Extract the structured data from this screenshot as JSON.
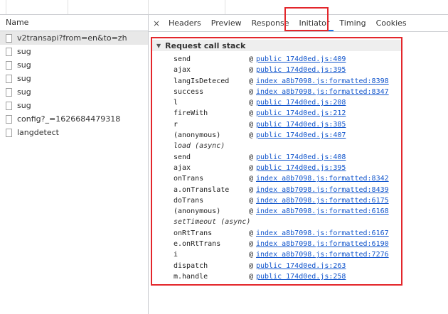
{
  "requests": {
    "header": "Name",
    "items": [
      {
        "name": "v2transapi?from=en&to=zh",
        "selected": true
      },
      {
        "name": "sug",
        "selected": false
      },
      {
        "name": "sug",
        "selected": false
      },
      {
        "name": "sug",
        "selected": false
      },
      {
        "name": "sug",
        "selected": false
      },
      {
        "name": "sug",
        "selected": false
      },
      {
        "name": "config?_=1626684479318",
        "selected": false
      },
      {
        "name": "langdetect",
        "selected": false
      }
    ]
  },
  "tabs": {
    "close": "×",
    "items": [
      "Headers",
      "Preview",
      "Response",
      "Initiator",
      "Timing",
      "Cookies"
    ],
    "active": "Initiator"
  },
  "stack": {
    "title": "Request call stack",
    "frames": [
      {
        "type": "frame",
        "fn": "send",
        "loc": "public 174d0ed.js:409"
      },
      {
        "type": "frame",
        "fn": "ajax",
        "loc": "public 174d0ed.js:395"
      },
      {
        "type": "frame",
        "fn": "langIsDeteced",
        "loc": "index a8b7098.js:formatted:8398"
      },
      {
        "type": "frame",
        "fn": "success",
        "loc": "index a8b7098.js:formatted:8347"
      },
      {
        "type": "frame",
        "fn": "l",
        "loc": "public 174d0ed.js:208"
      },
      {
        "type": "frame",
        "fn": "fireWith",
        "loc": "public 174d0ed.js:212"
      },
      {
        "type": "frame",
        "fn": "r",
        "loc": "public 174d0ed.js:385"
      },
      {
        "type": "frame",
        "fn": "(anonymous)",
        "loc": "public 174d0ed.js:407"
      },
      {
        "type": "async",
        "label": "load (async)"
      },
      {
        "type": "frame",
        "fn": "send",
        "loc": "public 174d0ed.js:408"
      },
      {
        "type": "frame",
        "fn": "ajax",
        "loc": "public 174d0ed.js:395"
      },
      {
        "type": "frame",
        "fn": "onTrans",
        "loc": "index a8b7098.js:formatted:8342"
      },
      {
        "type": "frame",
        "fn": "a.onTranslate",
        "loc": "index a8b7098.js:formatted:8439"
      },
      {
        "type": "frame",
        "fn": "doTrans",
        "loc": "index a8b7098.js:formatted:6175"
      },
      {
        "type": "frame",
        "fn": "(anonymous)",
        "loc": "index a8b7098.js:formatted:6168"
      },
      {
        "type": "async",
        "label": "setTimeout (async)"
      },
      {
        "type": "frame",
        "fn": "onRtTrans",
        "loc": "index a8b7098.js:formatted:6167"
      },
      {
        "type": "frame",
        "fn": "e.onRtTrans",
        "loc": "index a8b7098.js:formatted:6190"
      },
      {
        "type": "frame",
        "fn": "i",
        "loc": "index a8b7098.js:formatted:7276"
      },
      {
        "type": "frame",
        "fn": "dispatch",
        "loc": "public 174d0ed.js:263"
      },
      {
        "type": "frame",
        "fn": "m.handle",
        "loc": "public 174d0ed.js:258"
      }
    ]
  }
}
